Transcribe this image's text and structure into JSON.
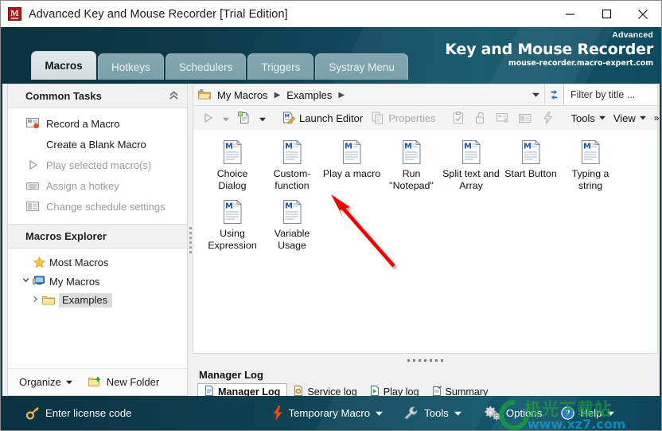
{
  "window": {
    "title": "Advanced Key and Mouse Recorder [Trial Edition]",
    "app_icon": "M",
    "minimize_label": "minimize-icon",
    "maximize_label": "maximize-icon",
    "close_label": "close-icon"
  },
  "banner": {
    "top_line": "Advanced",
    "main_line": "Key and Mouse Recorder",
    "url": "mouse-recorder.macro-expert.com"
  },
  "tabs": [
    {
      "label": "Macros",
      "active": true
    },
    {
      "label": "Hotkeys",
      "active": false
    },
    {
      "label": "Schedulers",
      "active": false
    },
    {
      "label": "Triggers",
      "active": false
    },
    {
      "label": "Systray Menu",
      "active": false
    }
  ],
  "sidebar": {
    "common_tasks_title": "Common Tasks",
    "collapse_icon": "chevron-double-up-icon",
    "tasks": [
      {
        "label": "Record a Macro",
        "icon": "record-macro-icon",
        "disabled": false
      },
      {
        "label": "Create a Blank Macro",
        "icon": "",
        "disabled": false
      },
      {
        "label": "Play selected macro(s)",
        "icon": "play-icon",
        "disabled": true
      },
      {
        "label": "Assign a hotkey",
        "icon": "keyboard-icon",
        "disabled": true
      },
      {
        "label": "Change schedule settings",
        "icon": "schedule-icon",
        "disabled": true
      }
    ],
    "explorer_title": "Macros Explorer",
    "tree": [
      {
        "label": "Most Macros",
        "icon": "star-icon",
        "level": 0,
        "twist": "",
        "selected": false
      },
      {
        "label": "My Macros",
        "icon": "computer-icon",
        "level": 0,
        "twist": "∨",
        "selected": false
      },
      {
        "label": "Examples",
        "icon": "folder-icon",
        "level": 1,
        "twist": "›",
        "selected": true
      }
    ],
    "organize_label": "Organize",
    "new_folder_label": "New Folder"
  },
  "address_bar": {
    "folder_icon": "folder-open-icon",
    "crumbs": [
      "My Macros",
      "Examples"
    ],
    "dropdown_icon": "chevron-down-icon",
    "refresh_icon": "refresh-icon",
    "filter_placeholder": "Filter by title ..."
  },
  "toolbar": {
    "play_icon": "play-icon",
    "play_caret": "chevron-down-icon",
    "new_macro_icon": "new-macro-icon",
    "new_caret": "chevron-down-icon",
    "launch_editor_label": "Launch Editor",
    "launch_editor_icon": "launch-editor-icon",
    "properties_label": "Properties",
    "properties_icon": "properties-icon",
    "icon_clipboard": "clipboard-icon",
    "icon_lock": "lock-icon",
    "icon_record": "record-icon",
    "icon_screen": "screen-icon",
    "icon_bolt": "bolt-icon",
    "tools_label": "Tools",
    "view_label": "View",
    "overflow_label": "»"
  },
  "macros": [
    {
      "name": "Choice Dialog"
    },
    {
      "name": "Custom-function"
    },
    {
      "name": "Play a macro"
    },
    {
      "name": "Run \"Notepad\""
    },
    {
      "name": "Split text and Array"
    },
    {
      "name": "Start Button"
    },
    {
      "name": "Typing a string"
    },
    {
      "name": "Using Expression"
    },
    {
      "name": "Variable Usage"
    }
  ],
  "annotation": {
    "type": "red-arrow",
    "color": "#ee0000",
    "points_to": "Play a macro"
  },
  "log_panel": {
    "title": "Manager Log",
    "tabs": [
      {
        "label": "Manager Log",
        "icon": "document-icon",
        "active": true
      },
      {
        "label": "Service log",
        "icon": "service-icon",
        "active": false
      },
      {
        "label": "Play log",
        "icon": "play-doc-icon",
        "active": false
      },
      {
        "label": "Summary",
        "icon": "summary-icon",
        "active": false
      }
    ]
  },
  "status_bar": {
    "license_label": "Enter license code",
    "license_icon": "key-icon",
    "temporary_macro_label": "Temporary Macro",
    "temporary_macro_icon": "bolt-icon",
    "tools_label": "Tools",
    "tools_icon": "wrench-icon",
    "options_label": "Options",
    "options_icon": "gears-icon",
    "help_label": "Help",
    "help_icon": "question-icon"
  },
  "watermark": {
    "cn_text": "极光下载站",
    "url_text": "www.xz7.com"
  },
  "colors": {
    "header_teal": "#0d3c4a",
    "header_blue": "#11566c",
    "accent_red": "#ee0000",
    "icon_blue": "#2a62b0"
  }
}
